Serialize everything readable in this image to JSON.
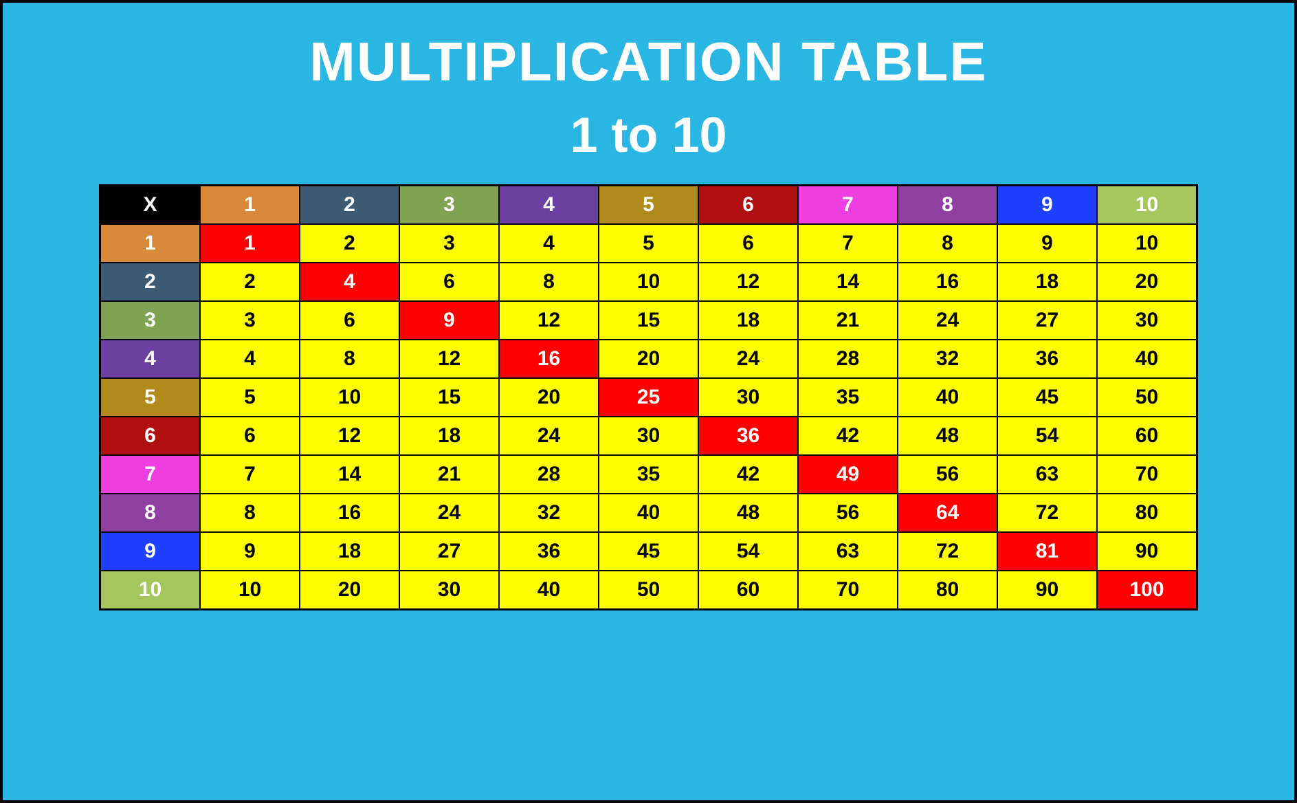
{
  "title": "MULTIPLICATION TABLE",
  "subtitle": "1 to 10",
  "corner_label": "X",
  "headers": [
    "1",
    "2",
    "3",
    "4",
    "5",
    "6",
    "7",
    "8",
    "9",
    "10"
  ],
  "header_colors": {
    "corner": "#000000",
    "1": "#d88a3a",
    "2": "#3d5a73",
    "3": "#7fa353",
    "4": "#6b3fa0",
    "5": "#b08a1a",
    "6": "#b00f0f",
    "7": "#ef3ee0",
    "8": "#8f3f9f",
    "9": "#1f3fff",
    "10": "#a4c65c"
  },
  "chart_data": {
    "type": "table",
    "title": "Multiplication Table 1 to 10",
    "x": [
      1,
      2,
      3,
      4,
      5,
      6,
      7,
      8,
      9,
      10
    ],
    "y": [
      1,
      2,
      3,
      4,
      5,
      6,
      7,
      8,
      9,
      10
    ],
    "rows": [
      [
        1,
        2,
        3,
        4,
        5,
        6,
        7,
        8,
        9,
        10
      ],
      [
        2,
        4,
        6,
        8,
        10,
        12,
        14,
        16,
        18,
        20
      ],
      [
        3,
        6,
        9,
        12,
        15,
        18,
        21,
        24,
        27,
        30
      ],
      [
        4,
        8,
        12,
        16,
        20,
        24,
        28,
        32,
        36,
        40
      ],
      [
        5,
        10,
        15,
        20,
        25,
        30,
        35,
        40,
        45,
        50
      ],
      [
        6,
        12,
        18,
        24,
        30,
        36,
        42,
        48,
        54,
        60
      ],
      [
        7,
        14,
        21,
        28,
        35,
        42,
        49,
        56,
        63,
        70
      ],
      [
        8,
        16,
        24,
        32,
        40,
        48,
        56,
        64,
        72,
        80
      ],
      [
        9,
        18,
        27,
        36,
        45,
        54,
        63,
        72,
        81,
        90
      ],
      [
        10,
        20,
        30,
        40,
        50,
        60,
        70,
        80,
        90,
        100
      ]
    ]
  }
}
